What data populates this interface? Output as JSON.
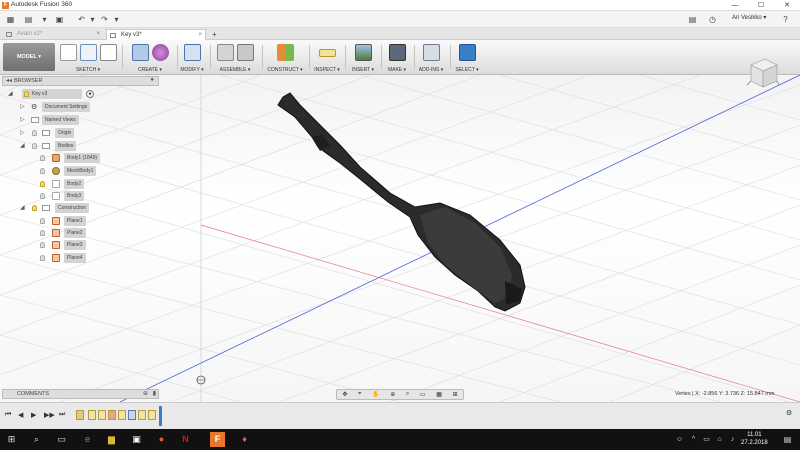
{
  "window": {
    "title": "Autodesk Fusion 360",
    "minimize": "—",
    "maximize": "☐",
    "close": "✕"
  },
  "quickbar": {
    "user": "Ari Vesikko ▾"
  },
  "tabs": [
    {
      "label": "Avain v2*",
      "close": "×"
    },
    {
      "label": "Key v3*",
      "close": "×"
    },
    {
      "label": "+"
    }
  ],
  "toolbar": {
    "mode": "MODEL ▾",
    "groups": [
      "SKETCH ▾",
      "CREATE ▾",
      "MODIFY ▾",
      "ASSEMBLE ▾",
      "CONSTRUCT ▾",
      "INSPECT ▾",
      "INSERT ▾",
      "MAKE ▾",
      "ADD-INS ▾",
      "SELECT ▾"
    ]
  },
  "browser": {
    "header": "BROWSER",
    "root": "Key v3",
    "items": [
      {
        "label": "Document Settings"
      },
      {
        "label": "Named Views"
      },
      {
        "label": "Origin"
      },
      {
        "label": "Bodies"
      },
      {
        "label": "Body1 (1849)"
      },
      {
        "label": "MeshBody1"
      },
      {
        "label": "Body2"
      },
      {
        "label": "Body3"
      },
      {
        "label": "Construction"
      },
      {
        "label": "Plane1"
      },
      {
        "label": "Plane2"
      },
      {
        "label": "Plane3"
      },
      {
        "label": "Plane4"
      }
    ]
  },
  "comments": {
    "header": "COMMENTS"
  },
  "status": {
    "vertex": "Vertex | X: -2.856 Y: 3.736 Z: 15.847 mm"
  },
  "taskbar": {
    "time": "11.01",
    "date": "27.2.2018"
  },
  "colors": {
    "accent": "#3b7ec8",
    "toolbar_bg": "#e3e3e3",
    "taskbar": "#111111",
    "mode": "#7a7a7a"
  }
}
